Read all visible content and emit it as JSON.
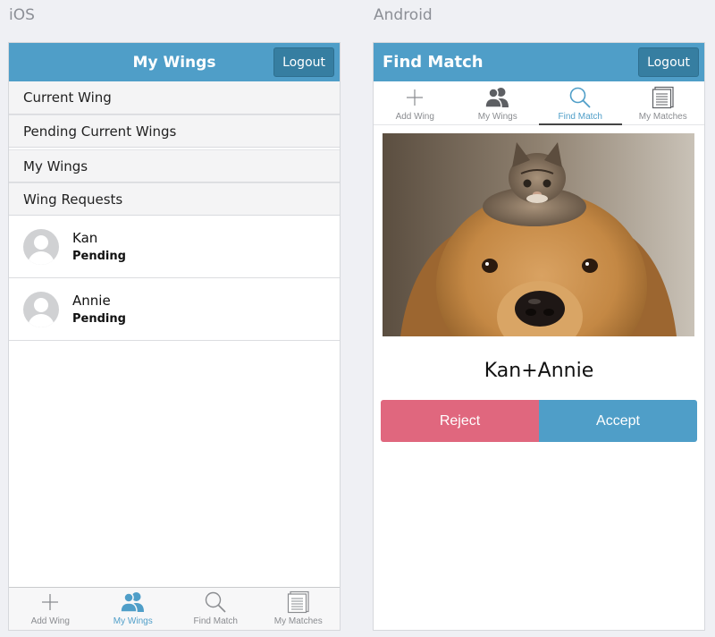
{
  "labels": {
    "ios": "iOS",
    "android": "Android"
  },
  "colors": {
    "primary": "#4f9ec8",
    "button_dark": "#367ea1",
    "reject": "#e0677e",
    "tab_inactive": "#8a8c90"
  },
  "ios": {
    "header": {
      "title": "My Wings",
      "logout_label": "Logout"
    },
    "sections": [
      "Current Wing",
      "Pending Current Wings",
      "My Wings",
      "Wing Requests"
    ],
    "requests": [
      {
        "name": "Kan",
        "status": "Pending"
      },
      {
        "name": "Annie",
        "status": "Pending"
      }
    ],
    "tabs": [
      {
        "label": "Add Wing",
        "icon": "plus-icon",
        "active": false
      },
      {
        "label": "My Wings",
        "icon": "people-icon",
        "active": true
      },
      {
        "label": "Find Match",
        "icon": "magnifier-icon",
        "active": false
      },
      {
        "label": "My Matches",
        "icon": "list-icon",
        "active": false
      }
    ]
  },
  "android": {
    "header": {
      "title": "Find Match",
      "logout_label": "Logout"
    },
    "tabs": [
      {
        "label": "Add Wing",
        "icon": "plus-icon",
        "active": false
      },
      {
        "label": "My Wings",
        "icon": "people-icon",
        "active": false
      },
      {
        "label": "Find Match",
        "icon": "magnifier-icon",
        "active": true
      },
      {
        "label": "My Matches",
        "icon": "list-icon",
        "active": false
      }
    ],
    "match": {
      "name": "Kan+Annie",
      "photo": "kitten-on-dog-photo"
    },
    "actions": {
      "reject_label": "Reject",
      "accept_label": "Accept"
    }
  }
}
